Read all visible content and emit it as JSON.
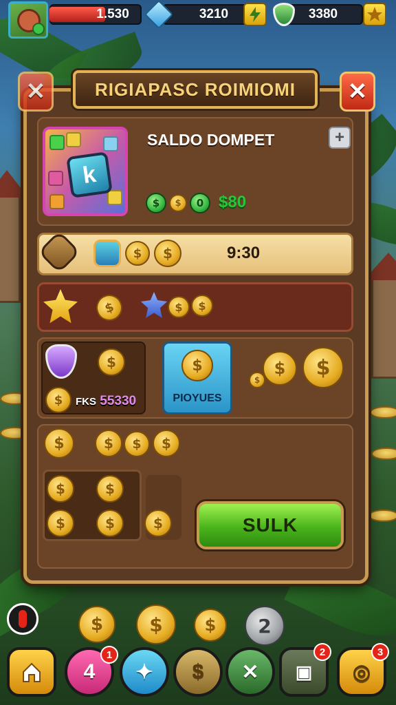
{
  "hud": {
    "health_value": "1.530",
    "health_fill_fraction": 0.62,
    "gems_value": "3210",
    "shields_value": "3380"
  },
  "dialog": {
    "title": "RIGIAPASC ROIMIOMI",
    "wallet_title": "SALDO DOMPET",
    "wallet_amount": "$80",
    "amount_row_value": "9:30",
    "mid_left_label_prefix": "FKS",
    "mid_left_label_value": "55330",
    "blue_card_label": "PIOYUES",
    "confirm_button": "SULK"
  },
  "bottom_nav": {
    "badges": [
      "1",
      "2",
      "3"
    ]
  },
  "colors": {
    "panel": "#5a3a22",
    "panel_border": "#c89a52",
    "confirm_green": "#4bb41c",
    "close_red": "#c02a14",
    "title_gold": "#f6d27a"
  },
  "icons": [
    "avatar",
    "gem-icon",
    "shield-icon",
    "star-icon",
    "close-icon",
    "plus-icon",
    "coin-icon",
    "gear-icon",
    "home-icon",
    "chest-icon"
  ]
}
